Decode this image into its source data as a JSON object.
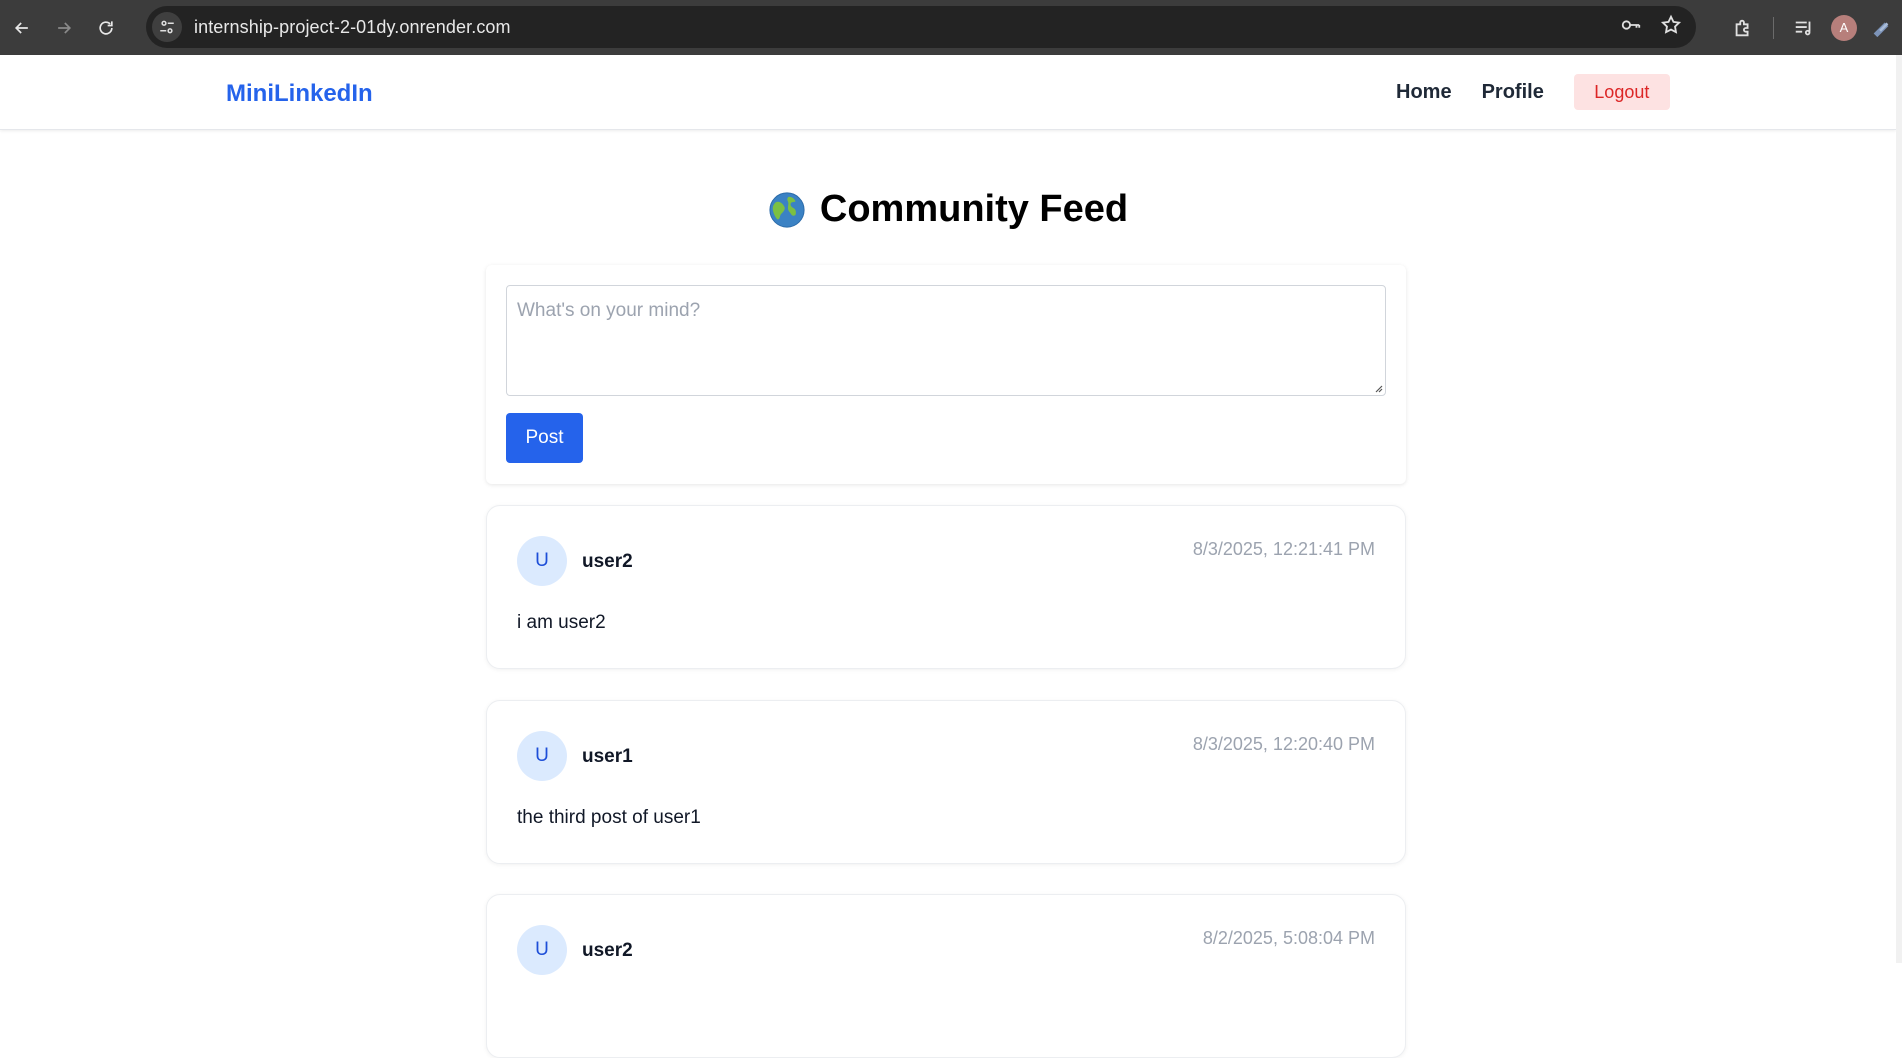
{
  "browser": {
    "url": "internship-project-2-01dy.onrender.com",
    "profile_initial": "A"
  },
  "navbar": {
    "brand": "MiniLinkedIn",
    "links": [
      "Home",
      "Profile"
    ],
    "logout_label": "Logout"
  },
  "feed": {
    "title": "Community Feed",
    "title_icon": "globe-icon",
    "composer": {
      "placeholder": "What's on your mind?",
      "value": "",
      "post_label": "Post"
    },
    "posts": [
      {
        "avatar_initial": "U",
        "username": "user2",
        "timestamp": "8/3/2025, 12:21:41 PM",
        "content": "i am user2"
      },
      {
        "avatar_initial": "U",
        "username": "user1",
        "timestamp": "8/3/2025, 12:20:40 PM",
        "content": "the third post of user1"
      },
      {
        "avatar_initial": "U",
        "username": "user2",
        "timestamp": "8/2/2025, 5:08:04 PM",
        "content": ""
      }
    ]
  },
  "colors": {
    "brand": "#2563eb",
    "logout_bg": "#fde2e2",
    "logout_text": "#dc2626",
    "avatar_bg": "#dbeafe"
  }
}
